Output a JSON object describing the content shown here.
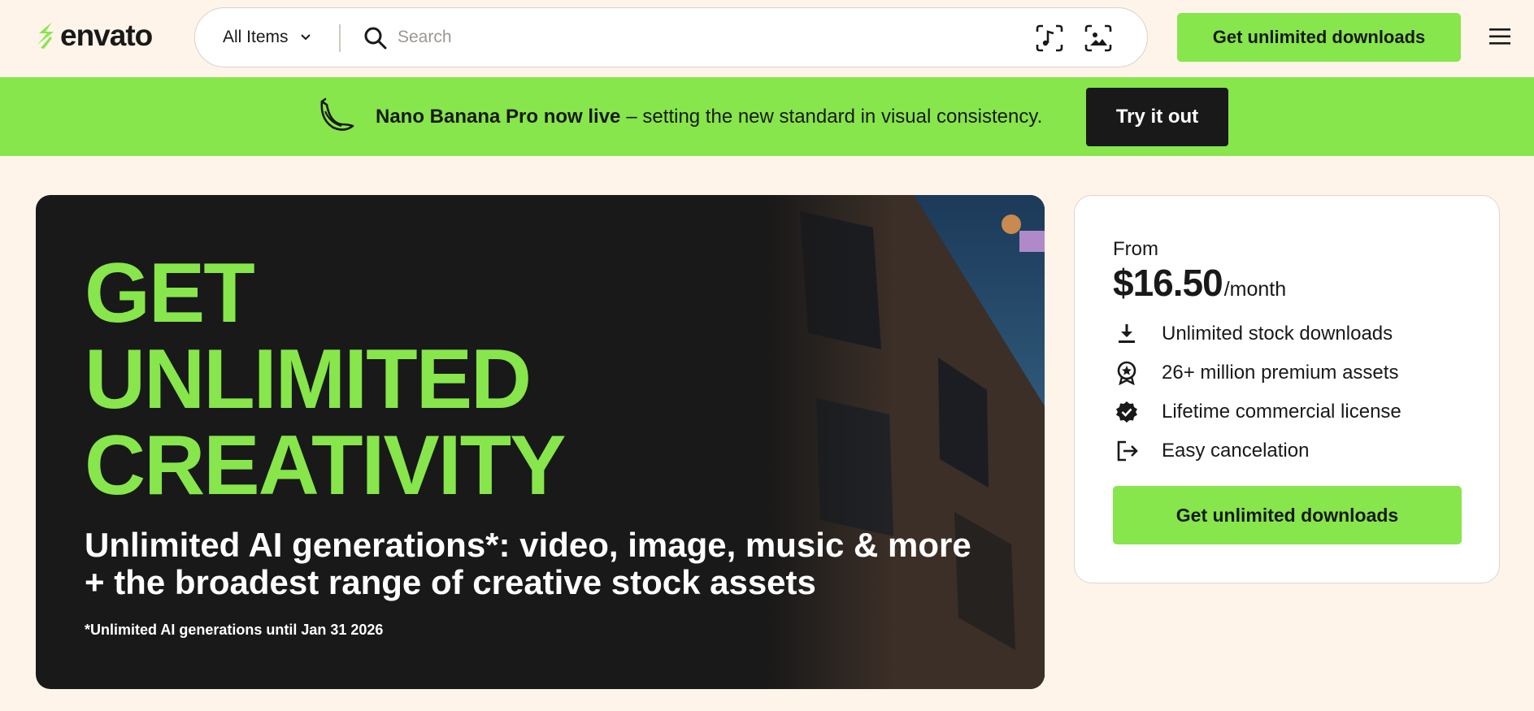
{
  "header": {
    "logo_text": "envato",
    "category_label": "All Items",
    "search_placeholder": "Search",
    "cta_label": "Get unlimited downloads"
  },
  "banner": {
    "headline_bold": "Nano Banana Pro now live",
    "headline_rest": "– setting the new standard in visual consistency.",
    "button_label": "Try it out"
  },
  "hero": {
    "title_lines": [
      "GET",
      "UNLIMITED",
      "CREATIVITY"
    ],
    "subtitle": "Unlimited AI generations*: video, image, music & more + the broadest range of creative stock assets",
    "footnote": "*Unlimited AI generations until Jan 31 2026"
  },
  "pricing": {
    "from_label": "From",
    "price": "$16.50",
    "period": "/month",
    "features": [
      {
        "icon": "download-icon",
        "label": "Unlimited stock downloads"
      },
      {
        "icon": "award-star-icon",
        "label": "26+ million premium assets"
      },
      {
        "icon": "verified-badge-icon",
        "label": "Lifetime commercial license"
      },
      {
        "icon": "exit-arrow-icon",
        "label": "Easy cancelation"
      }
    ],
    "cta_label": "Get unlimited downloads"
  },
  "colors": {
    "brand_green": "#87e64b",
    "page_background": "#fff4ea",
    "dark": "#191919"
  }
}
